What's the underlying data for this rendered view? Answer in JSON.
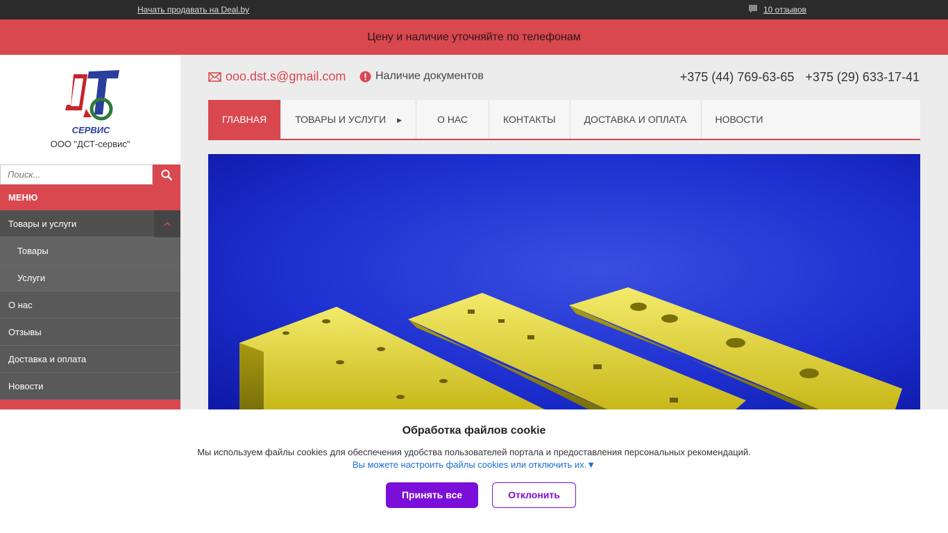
{
  "topbar": {
    "sell_link": "Начать продавать на Deal.by",
    "reviews_link": "10 отзывов",
    "reviews_icon": "comment-icon"
  },
  "banner": {
    "text": "Цену и наличие уточняйте по телефонам"
  },
  "logo": {
    "company_name": "ООО \"ДСТ-сервис\""
  },
  "search": {
    "placeholder": "Поиск..."
  },
  "sidebar": {
    "menu_title": "МЕНЮ",
    "items": [
      {
        "label": "Товары и услуги"
      },
      {
        "label": "Товары"
      },
      {
        "label": "Услуги"
      },
      {
        "label": "О нас"
      },
      {
        "label": "Отзывы"
      },
      {
        "label": "Доставка и оплата"
      },
      {
        "label": "Новости"
      }
    ]
  },
  "contacts": {
    "email": "ooo.dst.s@gmail.com",
    "docs": "Наличие документов",
    "phone1": "+375 (44) 769-63-65",
    "phone2": "+375 (29) 633-17-41"
  },
  "nav": {
    "tabs": [
      {
        "label": "Главная"
      },
      {
        "label": "Товары и услуги"
      },
      {
        "label": "О нас"
      },
      {
        "label": "Контакты"
      },
      {
        "label": "Доставка и оплата"
      },
      {
        "label": "Новости"
      }
    ]
  },
  "cookie": {
    "title": "Обработка файлов cookie",
    "text": "Мы используем файлы cookies для обеспечения удобства пользователей портала и предоставления персональных рекомендаций.",
    "link": "Вы можете настроить файлы cookies или отключить их.▼",
    "accept": "Принять все",
    "decline": "Отклонить"
  },
  "colors": {
    "accent": "#d9474f",
    "dark": "#2b2b2b",
    "purple": "#7b0fd9",
    "hero_blue": "#1d2fd0"
  }
}
